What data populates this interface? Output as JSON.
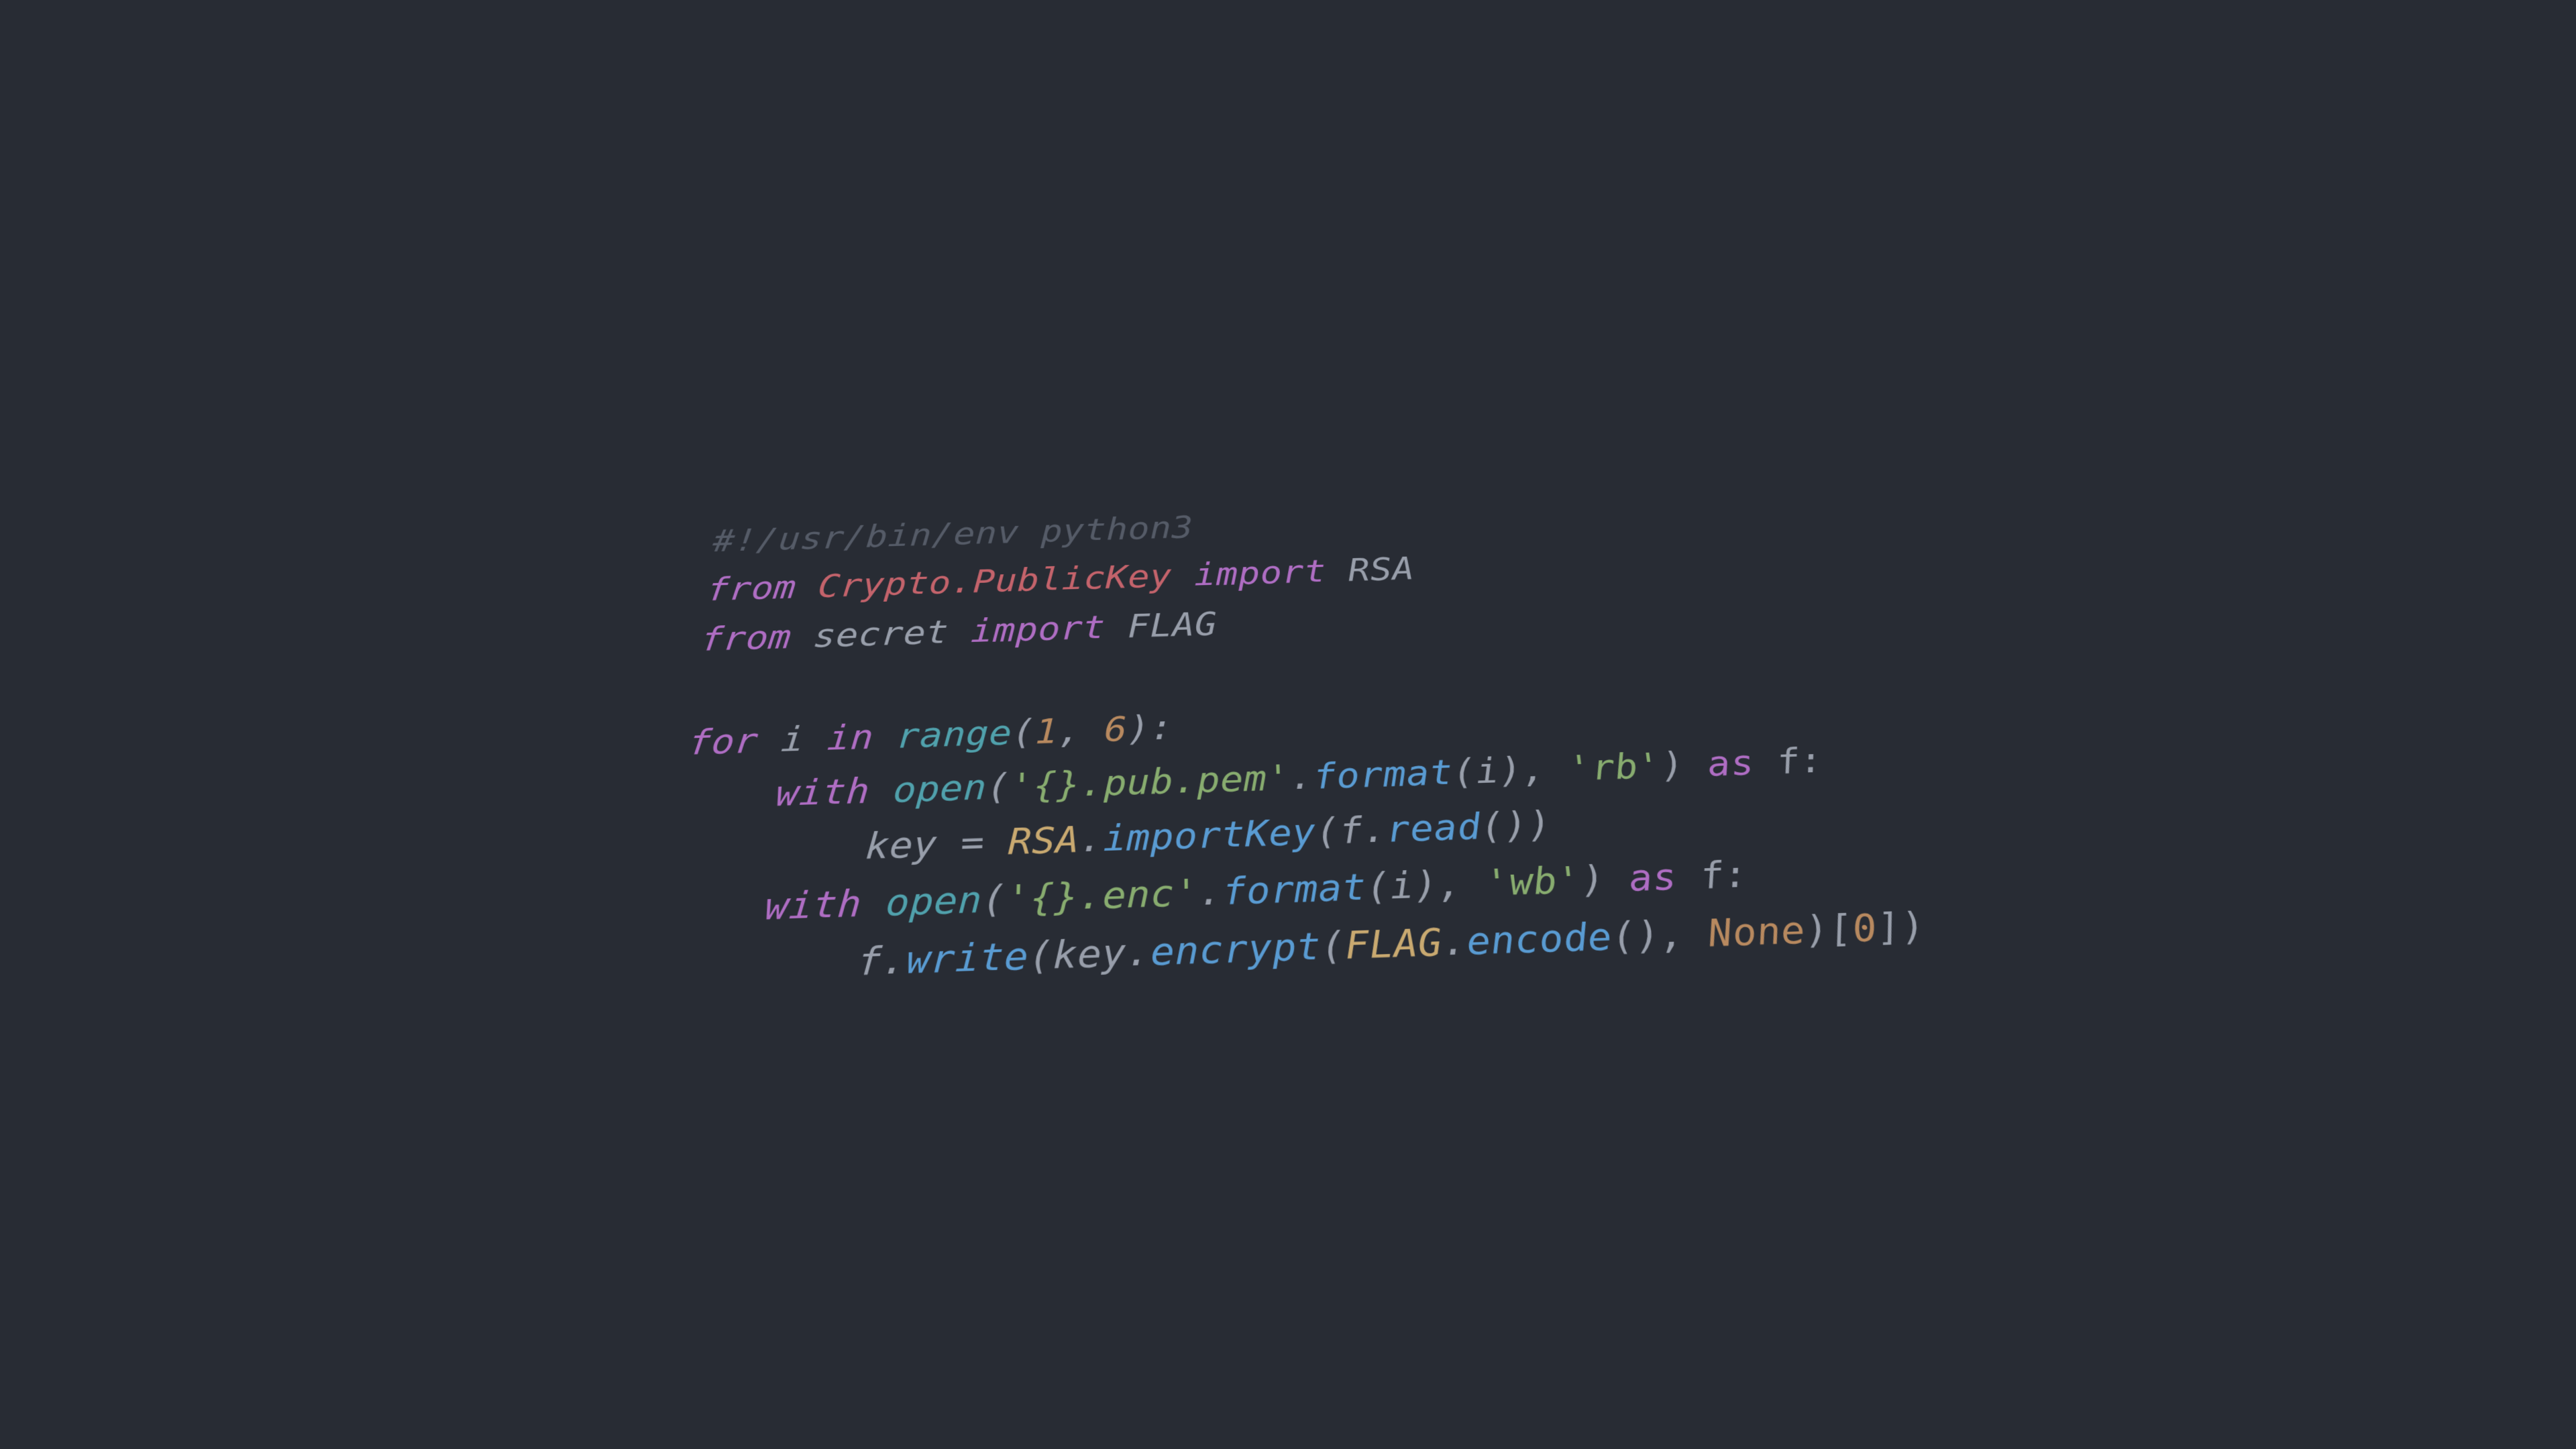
{
  "code": {
    "shebang": "#!/usr/bin/env python3",
    "kw_from": "from",
    "kw_import": "import",
    "mod_crypto": "Crypto.PublicKey",
    "sym_rsa": "RSA",
    "mod_secret": "secret",
    "sym_flag": "FLAG",
    "kw_for": "for",
    "var_i": "i",
    "kw_in": "in",
    "fn_range": "range",
    "num_1": "1",
    "num_6": "6",
    "kw_with": "with",
    "fn_open": "open",
    "str_pub": "'{}.pub.pem'",
    "fn_format": "format",
    "str_rb": "'rb'",
    "kw_as": "as",
    "var_f": "f",
    "var_key": "key",
    "op_eq": " = ",
    "cls_rsa": "RSA",
    "fn_importkey": "importKey",
    "fn_read": "read",
    "str_enc": "'{}.enc'",
    "str_wb": "'wb'",
    "fn_write": "write",
    "fn_encrypt": "encrypt",
    "var_flag": "FLAG",
    "fn_encode": "encode",
    "kw_none": "None",
    "num_0": "0",
    "paren_o": "(",
    "paren_c": ")",
    "brack_o": "[",
    "brack_c": "]",
    "comma": ", ",
    "dot": ".",
    "colon": ":"
  }
}
